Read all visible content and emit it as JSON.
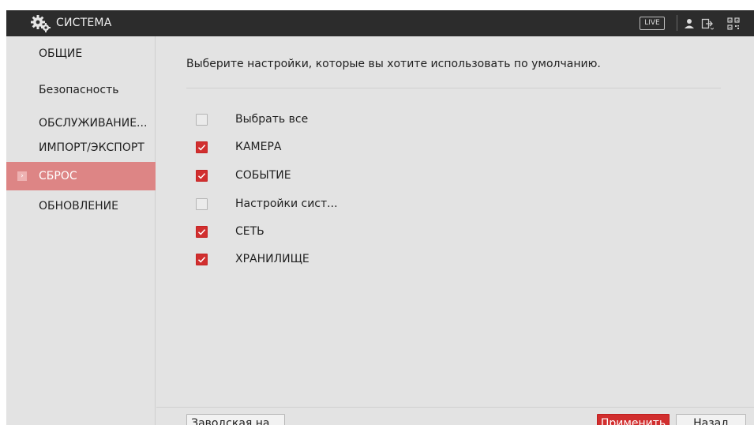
{
  "header": {
    "title": "СИСТЕМА",
    "logo_icon": "gears-icon",
    "live_label": "LIVE",
    "icons": [
      "user-icon",
      "logout-icon",
      "qr-code-icon"
    ]
  },
  "sidebar": {
    "items": [
      {
        "label": "ОБЩИЕ",
        "active": false
      },
      {
        "label": "Безопасность",
        "active": false
      },
      {
        "label": "ОБСЛУЖИВАНИЕ...",
        "active": false
      },
      {
        "label": "ИМПОРТ/ЭКСПОРТ",
        "active": false
      },
      {
        "label": "СБРОС",
        "active": true
      },
      {
        "label": "ОБНОВЛЕНИЕ",
        "active": false
      }
    ]
  },
  "main": {
    "prompt": "Выберите настройки, которые вы хотите использовать по умолчанию.",
    "options": [
      {
        "label": "Выбрать все",
        "checked": false
      },
      {
        "label": "КАМЕРА",
        "checked": true
      },
      {
        "label": "СОБЫТИЕ",
        "checked": true
      },
      {
        "label": "Настройки сист...",
        "checked": false
      },
      {
        "label": "СЕТЬ",
        "checked": true
      },
      {
        "label": "ХРАНИЛИЩЕ",
        "checked": true
      }
    ]
  },
  "footer": {
    "factory_label": "Заводская на...",
    "apply_label": "Применить",
    "back_label": "Назад"
  },
  "colors": {
    "accent": "#d12f2f",
    "active_item": "#dd8585",
    "header_bg": "#2c2c2c",
    "panel_bg": "#e3e3e3"
  }
}
